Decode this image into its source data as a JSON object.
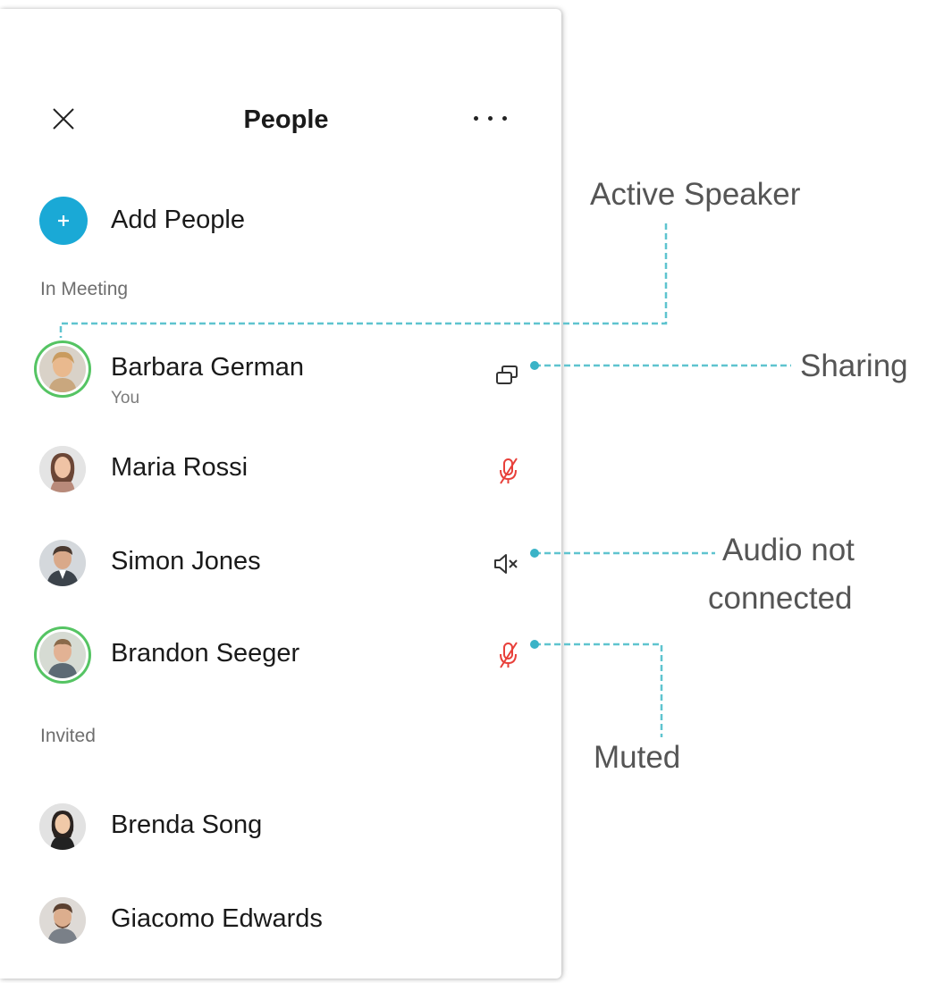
{
  "panel": {
    "title": "People",
    "add_people_label": "Add People",
    "sections": {
      "in_meeting": "In Meeting",
      "invited": "Invited"
    },
    "participants": [
      {
        "name": "Barbara German",
        "subtitle": "You",
        "status_icon": "share-screen-icon",
        "active_speaker": true
      },
      {
        "name": "Maria Rossi",
        "status_icon": "muted-mic-icon"
      },
      {
        "name": "Simon Jones",
        "status_icon": "speaker-off-icon"
      },
      {
        "name": "Brandon Seeger",
        "status_icon": "muted-mic-icon",
        "active_speaker": true
      }
    ],
    "invited": [
      {
        "name": "Brenda Song"
      },
      {
        "name": "Giacomo Edwards"
      }
    ]
  },
  "annotations": {
    "active_speaker": "Active Speaker",
    "sharing": "Sharing",
    "audio_not_connected_line1": "Audio not",
    "audio_not_connected_line2": "connected",
    "muted": "Muted"
  },
  "colors": {
    "accent": "#1aa9d6",
    "callout": "#5fc4cf",
    "speaker_ring": "#55c463",
    "muted_red": "#e8403a"
  },
  "icons": {
    "close": "close-icon",
    "more": "more-icon",
    "add": "plus-icon"
  }
}
